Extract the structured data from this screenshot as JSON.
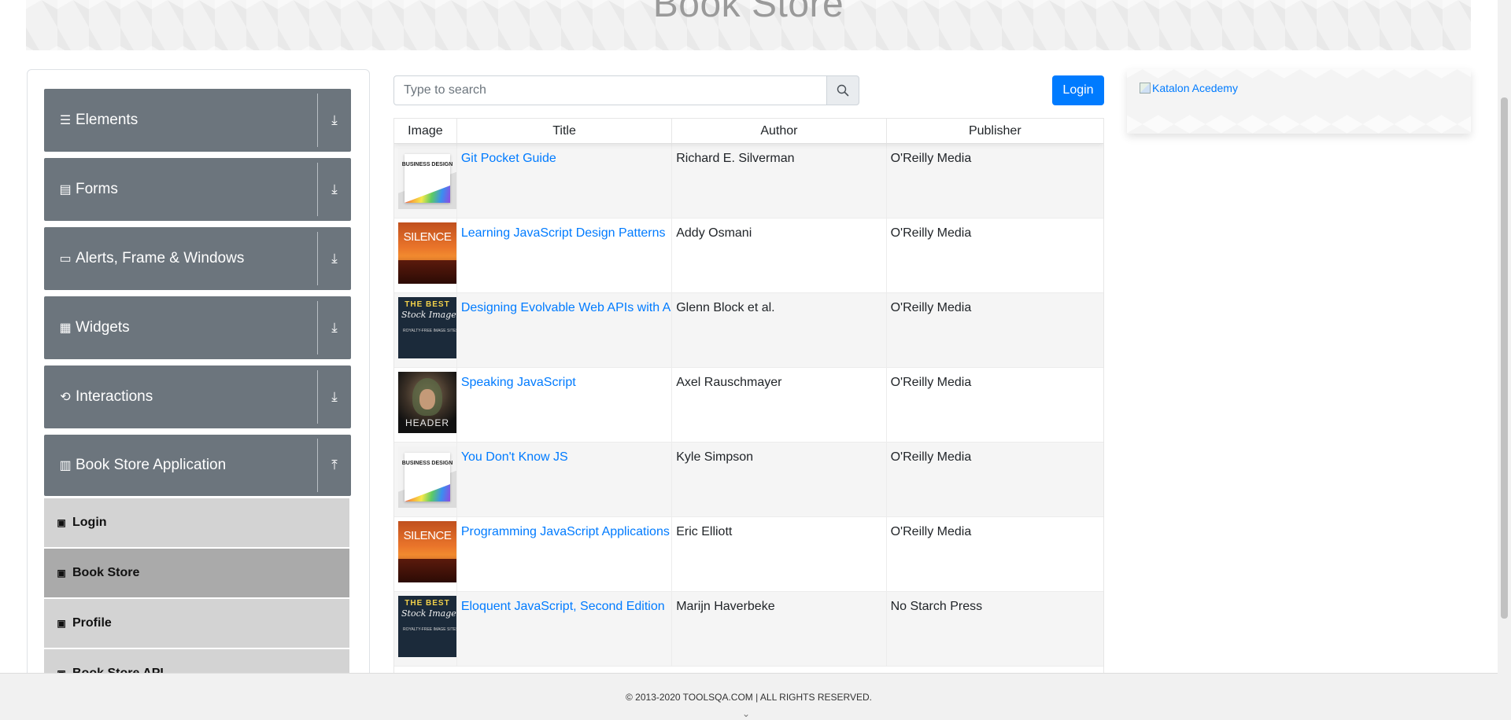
{
  "header": {
    "title": "Book Store"
  },
  "sidebar": {
    "groups": [
      {
        "label": "Elements",
        "icon": "menu-icon",
        "expanded": false
      },
      {
        "label": "Forms",
        "icon": "document-icon",
        "expanded": false
      },
      {
        "label": "Alerts, Frame & Windows",
        "icon": "window-icon",
        "expanded": false
      },
      {
        "label": "Widgets",
        "icon": "grid-icon",
        "expanded": false
      },
      {
        "label": "Interactions",
        "icon": "interaction-icon",
        "expanded": false
      },
      {
        "label": "Book Store Application",
        "icon": "books-icon",
        "expanded": true
      }
    ],
    "subitems": [
      {
        "label": "Login",
        "active": false
      },
      {
        "label": "Book Store",
        "active": true
      },
      {
        "label": "Profile",
        "active": false
      },
      {
        "label": "Book Store API",
        "active": false
      }
    ]
  },
  "search": {
    "placeholder": "Type to search",
    "value": ""
  },
  "login_button": "Login",
  "ad": {
    "alt_text": "Katalon Acedemy"
  },
  "table": {
    "headers": [
      "Image",
      "Title",
      "Author",
      "Publisher"
    ],
    "rows": [
      {
        "cover": "business-design",
        "title": "Git Pocket Guide",
        "author": "Richard E. Silverman",
        "publisher": "O'Reilly Media"
      },
      {
        "cover": "silence",
        "title": "Learning JavaScript Design Patterns",
        "author": "Addy Osmani",
        "publisher": "O'Reilly Media"
      },
      {
        "cover": "the-best",
        "title": "Designing Evolvable Web APIs with ASP.NET",
        "author": "Glenn Block et al.",
        "publisher": "O'Reilly Media"
      },
      {
        "cover": "header",
        "title": "Speaking JavaScript",
        "author": "Axel Rauschmayer",
        "publisher": "O'Reilly Media"
      },
      {
        "cover": "business-design",
        "title": "You Don't Know JS",
        "author": "Kyle Simpson",
        "publisher": "O'Reilly Media"
      },
      {
        "cover": "silence",
        "title": "Programming JavaScript Applications",
        "author": "Eric Elliott",
        "publisher": "O'Reilly Media"
      },
      {
        "cover": "the-best",
        "title": "Eloquent JavaScript, Second Edition",
        "author": "Marijn Haverbeke",
        "publisher": "No Starch Press"
      }
    ]
  },
  "covers": {
    "business-design": {
      "text": "BUSINESS DESIGN"
    },
    "silence": {
      "text": "SILENCE"
    },
    "the-best": {
      "text": "THE BEST",
      "script": "Stock Images",
      "small": "ROYALTY-FREE IMAGE SITES FOR BOOK COVERS"
    },
    "header": {
      "text": "HEADER"
    }
  },
  "footer": {
    "text": "© 2013-2020 TOOLSQA.COM | ALL RIGHTS RESERVED."
  },
  "colors": {
    "accent": "#007bff",
    "sidebar_group": "#6c757d",
    "sub_item": "#d3d3d3",
    "sub_item_active": "#aaaaaa"
  }
}
